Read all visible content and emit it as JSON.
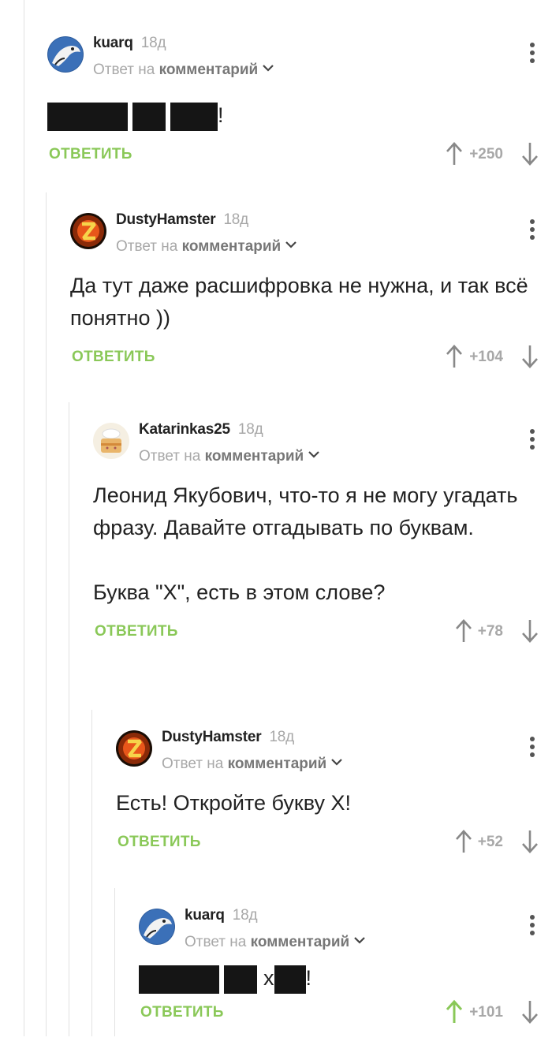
{
  "colors": {
    "accent": "#8ac858",
    "muted": "#a8a8a8",
    "text": "#222222",
    "redaction": "#151515"
  },
  "comments": [
    {
      "username": "kuarq",
      "time": "18д",
      "reply_prefix": "Ответ на",
      "reply_target": "комментарий",
      "text_suffix": "!",
      "reply_label": "ОТВЕТИТЬ",
      "score": "+250",
      "avatar_icon": "hawk-avatar-icon"
    },
    {
      "username": "DustyHamster",
      "time": "18д",
      "reply_prefix": "Ответ на",
      "reply_target": "комментарий",
      "text": "Да тут даже расшифровка не нужна, и так всё понятно ))",
      "reply_label": "ОТВЕТИТЬ",
      "score": "+104",
      "avatar_icon": "flaming-z-avatar-icon"
    },
    {
      "username": "Katarinkas25",
      "time": "18д",
      "reply_prefix": "Ответ на",
      "reply_target": "комментарий",
      "text": "Леонид Якубович, что-то я не могу угадать фразу. Давайте отгадывать по буквам.",
      "text2": "Буква \"Х\", есть в этом слове?",
      "reply_label": "ОТВЕТИТЬ",
      "score": "+78",
      "avatar_icon": "cake-avatar-icon"
    },
    {
      "username": "DustyHamster",
      "time": "18д",
      "reply_prefix": "Ответ на",
      "reply_target": "комментарий",
      "text": "Есть! Откройте букву Х!",
      "reply_label": "ОТВЕТИТЬ",
      "score": "+52",
      "avatar_icon": "flaming-z-avatar-icon"
    },
    {
      "username": "kuarq",
      "time": "18д",
      "reply_prefix": "Ответ на",
      "reply_target": "комментарий",
      "text_mid": "х",
      "text_suffix": "!",
      "reply_label": "ОТВЕТИТЬ",
      "score": "+101",
      "avatar_icon": "hawk-avatar-icon",
      "upvoted": true
    }
  ]
}
